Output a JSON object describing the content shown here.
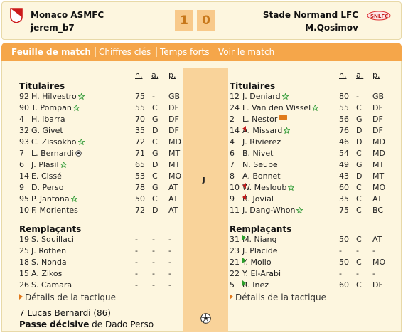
{
  "header": {
    "home_team": "Monaco ASMFC",
    "home_coach": "jerem_b7",
    "away_team": "Stade Normand LFC",
    "away_coach": "M.Qosimov",
    "home_score": "1",
    "away_score": "0"
  },
  "tabs": [
    {
      "label": "Feuille de match",
      "active": true
    },
    {
      "label": "Chiffres clés",
      "active": false
    },
    {
      "label": "Temps forts",
      "active": false
    },
    {
      "label": "Voir le match",
      "active": false
    }
  ],
  "columns": {
    "n": "n.",
    "a": "a.",
    "p": "p."
  },
  "center_label": "J",
  "home": {
    "starters_title": "Titulaires",
    "subs_title": "Remplaçants",
    "starters": [
      {
        "num": "92",
        "name": "H. Hilvestro",
        "icon": "star-icon",
        "n": "75",
        "a": "-",
        "p": "GB"
      },
      {
        "num": "90",
        "name": "T. Pompan",
        "icon": "star-icon",
        "n": "55",
        "a": "C",
        "p": "DF"
      },
      {
        "num": "4",
        "name": "H. Ibarra",
        "icon": "",
        "n": "70",
        "a": "G",
        "p": "DF"
      },
      {
        "num": "32",
        "name": "G. Givet",
        "icon": "",
        "n": "35",
        "a": "D",
        "p": "DF"
      },
      {
        "num": "93",
        "name": "C. Zissokho",
        "icon": "star-icon",
        "n": "72",
        "a": "C",
        "p": "MD"
      },
      {
        "num": "7",
        "name": "L. Bernardi",
        "icon": "ball-icon",
        "n": "71",
        "a": "G",
        "p": "MT"
      },
      {
        "num": "6",
        "name": "J. Plasil",
        "icon": "star-icon",
        "n": "65",
        "a": "D",
        "p": "MT"
      },
      {
        "num": "14",
        "name": "E. Cissé",
        "icon": "",
        "n": "53",
        "a": "C",
        "p": "MO"
      },
      {
        "num": "9",
        "name": "D. Perso",
        "icon": "",
        "n": "78",
        "a": "G",
        "p": "AT"
      },
      {
        "num": "95",
        "name": "P. Jantona",
        "icon": "star-icon",
        "n": "50",
        "a": "C",
        "p": "AT"
      },
      {
        "num": "10",
        "name": "F. Morientes",
        "icon": "",
        "n": "72",
        "a": "D",
        "p": "AT"
      }
    ],
    "subs": [
      {
        "num": "19",
        "name": "S. Squillaci",
        "n": "-",
        "a": "-",
        "p": "-"
      },
      {
        "num": "25",
        "name": "J. Rothen",
        "n": "-",
        "a": "-",
        "p": "-"
      },
      {
        "num": "18",
        "name": "S. Nonda",
        "n": "-",
        "a": "-",
        "p": "-"
      },
      {
        "num": "15",
        "name": "A. Zikos",
        "n": "-",
        "a": "-",
        "p": "-"
      },
      {
        "num": "26",
        "name": "S. Camara",
        "n": "-",
        "a": "-",
        "p": "-"
      }
    ],
    "tactic_link": "Détails de la tactique"
  },
  "away": {
    "starters_title": "Titulaires",
    "subs_title": "Remplaçants",
    "starters": [
      {
        "num": "12",
        "name": "J. Deniard",
        "icon": "star-icon",
        "pre": "",
        "n": "80",
        "a": "-",
        "p": "GB"
      },
      {
        "num": "24",
        "name": "L. Van den Wissel",
        "icon": "star-icon",
        "pre": "",
        "n": "55",
        "a": "C",
        "p": "DF"
      },
      {
        "num": "2",
        "name": "L. Nestor",
        "icon": "card-icon",
        "pre": "",
        "n": "56",
        "a": "G",
        "p": "DF"
      },
      {
        "num": "14",
        "name": "A. Missard",
        "icon": "star-icon",
        "pre": "sub-out",
        "n": "76",
        "a": "D",
        "p": "DF"
      },
      {
        "num": "4",
        "name": "J. Rivierez",
        "icon": "",
        "pre": "",
        "n": "46",
        "a": "D",
        "p": "MD"
      },
      {
        "num": "6",
        "name": "B. Nivet",
        "icon": "",
        "pre": "",
        "n": "54",
        "a": "C",
        "p": "MD"
      },
      {
        "num": "7",
        "name": "N. Seube",
        "icon": "",
        "pre": "",
        "n": "49",
        "a": "G",
        "p": "MT"
      },
      {
        "num": "8",
        "name": "A. Bonnet",
        "icon": "",
        "pre": "",
        "n": "43",
        "a": "D",
        "p": "MT"
      },
      {
        "num": "10",
        "name": "W. Mesloub",
        "icon": "star-icon",
        "pre": "sub-out",
        "n": "60",
        "a": "C",
        "p": "MO"
      },
      {
        "num": "9",
        "name": "B. Jovial",
        "icon": "",
        "pre": "sub-out",
        "n": "35",
        "a": "C",
        "p": "AT"
      },
      {
        "num": "11",
        "name": "J. Dang-Whon",
        "icon": "star-icon",
        "pre": "",
        "n": "75",
        "a": "C",
        "p": "BC"
      }
    ],
    "subs": [
      {
        "num": "31",
        "name": "M. Niang",
        "pre": "sub-in",
        "n": "50",
        "a": "C",
        "p": "AT"
      },
      {
        "num": "23",
        "name": "J. Placide",
        "pre": "",
        "n": "-",
        "a": "-",
        "p": "-"
      },
      {
        "num": "21",
        "name": "Y. Mollo",
        "pre": "sub-in",
        "n": "50",
        "a": "C",
        "p": "MO"
      },
      {
        "num": "22",
        "name": "Y. El-Arabi",
        "pre": "",
        "n": "-",
        "a": "-",
        "p": "-"
      },
      {
        "num": "5",
        "name": "R. Inez",
        "pre": "sub-in",
        "n": "60",
        "a": "C",
        "p": "DF"
      }
    ],
    "tactic_link": "Détails de la tactique"
  },
  "goal": {
    "line": "7   Lucas Bernardi (86)",
    "assist_label": "Passe décisive",
    "assist_rest": " de Dado Perso"
  },
  "colors": {
    "accent": "#f5a64a",
    "panel": "#fdf6df",
    "strip": "#f9d39a",
    "score_bg": "#f8c98a",
    "score_fg": "#c7771a"
  }
}
